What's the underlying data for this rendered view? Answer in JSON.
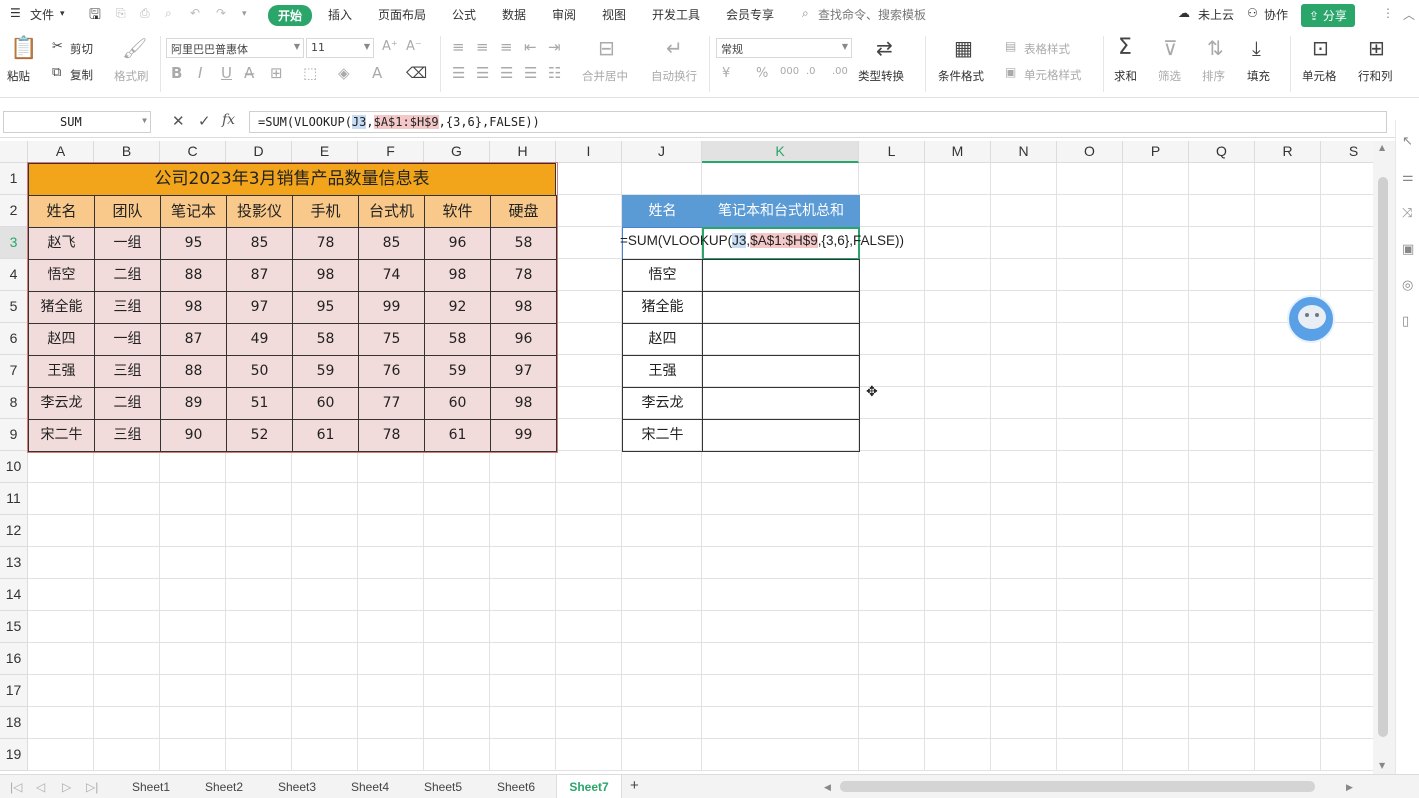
{
  "menubar": {
    "file_menu": "文件",
    "tabs": [
      "开始",
      "插入",
      "页面布局",
      "公式",
      "数据",
      "审阅",
      "视图",
      "开发工具",
      "会员专享"
    ],
    "active_tab": "开始",
    "search_placeholder": "查找命令、搜索模板",
    "cloud_status": "未上云",
    "collab": "协作",
    "share": "分享"
  },
  "ribbon": {
    "paste": "粘贴",
    "cut": "剪切",
    "copy": "复制",
    "format_painter": "格式刷",
    "font_name": "阿里巴巴普惠体",
    "font_size": "11",
    "merge_center": "合并居中",
    "wrap_text": "自动换行",
    "number_format": "常规",
    "type_convert": "类型转换",
    "conditional_format": "条件格式",
    "table_style": "表格样式",
    "cell_style": "单元格样式",
    "sum": "求和",
    "filter": "筛选",
    "sort": "排序",
    "fill": "填充",
    "cell": "单元格",
    "row_col": "行和列"
  },
  "formula_bar": {
    "name_box": "SUM",
    "formula_prefix": "=SUM(VLOOKUP(",
    "formula_ref1": "J3",
    "formula_sep1": ",",
    "formula_ref2": "$A$1:$H$9",
    "formula_rest": ",{3,6},FALSE))"
  },
  "grid": {
    "columns": [
      "A",
      "B",
      "C",
      "D",
      "E",
      "F",
      "G",
      "H",
      "I",
      "J",
      "K",
      "L",
      "M",
      "N",
      "O",
      "P",
      "Q",
      "R",
      "S"
    ],
    "rows": [
      "1",
      "2",
      "3",
      "4",
      "5",
      "6",
      "7",
      "8",
      "9",
      "10",
      "11",
      "12",
      "13",
      "14",
      "15",
      "16",
      "17",
      "18",
      "19"
    ],
    "selected_column": "K",
    "selected_row": "3"
  },
  "sales_table": {
    "title": "公司2023年3月销售产品数量信息表",
    "headers": [
      "姓名",
      "团队",
      "笔记本",
      "投影仪",
      "手机",
      "台式机",
      "软件",
      "硬盘"
    ],
    "rows": [
      [
        "赵飞",
        "一组",
        "95",
        "85",
        "78",
        "85",
        "96",
        "58"
      ],
      [
        "悟空",
        "二组",
        "88",
        "87",
        "98",
        "74",
        "98",
        "78"
      ],
      [
        "猪全能",
        "三组",
        "98",
        "97",
        "95",
        "99",
        "92",
        "98"
      ],
      [
        "赵四",
        "一组",
        "87",
        "49",
        "58",
        "75",
        "58",
        "96"
      ],
      [
        "王强",
        "三组",
        "88",
        "50",
        "59",
        "76",
        "59",
        "97"
      ],
      [
        "李云龙",
        "二组",
        "89",
        "51",
        "60",
        "77",
        "60",
        "98"
      ],
      [
        "宋二牛",
        "三组",
        "90",
        "52",
        "61",
        "78",
        "61",
        "99"
      ]
    ]
  },
  "lookup_table": {
    "header_name": "姓名",
    "header_sum": "笔记本和台式机总和",
    "editing_formula_prefix": "=SUM(VLOOKUP(",
    "editing_ref1": "J3",
    "editing_sep": ",",
    "editing_ref2": "$A$1:$H$9",
    "editing_rest": ",{3,6},FALSE))",
    "names": [
      "悟空",
      "猪全能",
      "赵四",
      "王强",
      "李云龙",
      "宋二牛"
    ]
  },
  "sheet_tabs": {
    "tabs": [
      "Sheet1",
      "Sheet2",
      "Sheet3",
      "Sheet4",
      "Sheet5",
      "Sheet6",
      "Sheet7"
    ],
    "active": "Sheet7",
    "add": "+"
  },
  "colors": {
    "accent": "#2aa66b",
    "title_fill": "#f2a51a",
    "header_fill": "#f8c98a",
    "body_fill": "#f2dcdb",
    "lookup_header_fill": "#5b9bd5"
  }
}
